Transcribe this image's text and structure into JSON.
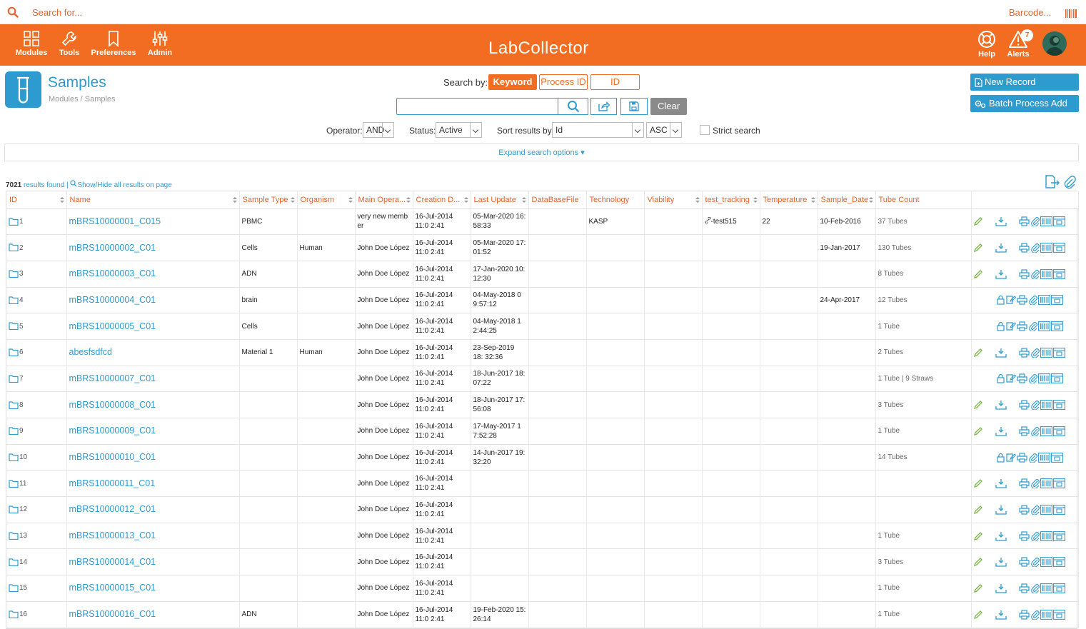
{
  "topbar": {
    "search_placeholder": "Search for...",
    "barcode_label": "Barcode..."
  },
  "nav": {
    "modules": "Modules",
    "tools": "Tools",
    "preferences": "Preferences",
    "admin": "Admin",
    "logo": "LabCollector",
    "help": "Help",
    "alerts": "Alerts",
    "alert_count": "7"
  },
  "page": {
    "title": "Samples",
    "breadcrumb": "Modules / Samples",
    "search_by_label": "Search by:",
    "search_by_options": [
      "Keyword",
      "Process ID",
      "ID"
    ],
    "clear_label": "Clear",
    "operator_label": "Operator:",
    "operator_value": "AND",
    "status_label": "Status:",
    "status_value": "Active",
    "sort_label": "Sort results by:",
    "sort_value": "Id",
    "sort_dir": "ASC",
    "strict_label": "Strict search",
    "new_record": "New Record",
    "batch_add": "Batch Process Add",
    "expand_label": "Expand search options ▾",
    "results_count": "7021",
    "results_label": " results found | ",
    "show_hide": "Show/Hide all results on page"
  },
  "table": {
    "headers": [
      "ID",
      "Name",
      "Sample Type",
      "Organism",
      "Main Opera...",
      "Creation D...",
      "Last Update",
      "DataBaseFile",
      "Technology",
      "Viability",
      "test_tracking",
      "Temperature",
      "Sample_Date",
      "Tube Count"
    ],
    "rows": [
      {
        "id": "1",
        "name": "mBRS10000001_C015",
        "type": "PBMC",
        "org": "",
        "op": "very new memb er",
        "created": "16-Jul-2014 11:0 2:41",
        "updated": "05-Mar-2020 16: 58:33",
        "db": "",
        "tech": "KASP",
        "via": "",
        "track": "-test515",
        "temp": "22",
        "sdate": "10-Feb-2016",
        "tubes": "37 Tubes",
        "locked": false
      },
      {
        "id": "2",
        "name": "mBRS10000002_C01",
        "type": "Cells",
        "org": "Human",
        "op": "John Doe López",
        "created": "16-Jul-2014 11:0 2:41",
        "updated": "05-Mar-2020 17: 01:52",
        "db": "",
        "tech": "",
        "via": "",
        "track": "",
        "temp": "",
        "sdate": "19-Jan-2017",
        "tubes": "130 Tubes",
        "locked": false
      },
      {
        "id": "3",
        "name": "mBRS10000003_C01",
        "type": "ADN",
        "org": "",
        "op": "John Doe López",
        "created": "16-Jul-2014 11:0 2:41",
        "updated": "17-Jan-2020 10: 12:30",
        "db": "",
        "tech": "",
        "via": "",
        "track": "",
        "temp": "",
        "sdate": "",
        "tubes": "8 Tubes",
        "locked": false
      },
      {
        "id": "4",
        "name": "mBRS10000004_C01",
        "type": "brain",
        "org": "",
        "op": "John Doe López",
        "created": "16-Jul-2014 11:0 2:41",
        "updated": "04-May-2018 0 9:57:12",
        "db": "",
        "tech": "",
        "via": "",
        "track": "",
        "temp": "",
        "sdate": "24-Apr-2017",
        "tubes": "12 Tubes",
        "locked": true
      },
      {
        "id": "5",
        "name": "mBRS10000005_C01",
        "type": "Cells",
        "org": "",
        "op": "John Doe López",
        "created": "16-Jul-2014 11:0 2:41",
        "updated": "04-May-2018 1 2:44:25",
        "db": "",
        "tech": "",
        "via": "",
        "track": "",
        "temp": "",
        "sdate": "",
        "tubes": "1 Tube",
        "locked": true
      },
      {
        "id": "6",
        "name": "abesfsdfcd",
        "type": "Material 1",
        "org": "Human",
        "op": "John Doe López",
        "created": "16-Jul-2014 11:0 2:41",
        "updated": "23-Sep-2019 18: 32:36",
        "db": "",
        "tech": "",
        "via": "",
        "track": "",
        "temp": "",
        "sdate": "",
        "tubes": "2 Tubes",
        "locked": false
      },
      {
        "id": "7",
        "name": "mBRS10000007_C01",
        "type": "",
        "org": "",
        "op": "John Doe López",
        "created": "16-Jul-2014 11:0 2:41",
        "updated": "18-Jun-2017 18: 07:22",
        "db": "",
        "tech": "",
        "via": "",
        "track": "",
        "temp": "",
        "sdate": "",
        "tubes": "1 Tube | 9 Straws",
        "locked": true
      },
      {
        "id": "8",
        "name": "mBRS10000008_C01",
        "type": "",
        "org": "",
        "op": "John Doe López",
        "created": "16-Jul-2014 11:0 2:41",
        "updated": "18-Jun-2017 17: 56:08",
        "db": "",
        "tech": "",
        "via": "",
        "track": "",
        "temp": "",
        "sdate": "",
        "tubes": "3 Tubes",
        "locked": false
      },
      {
        "id": "9",
        "name": "mBRS10000009_C01",
        "type": "",
        "org": "",
        "op": "John Doe López",
        "created": "16-Jul-2014 11:0 2:41",
        "updated": "17-May-2017 1 7:52:28",
        "db": "",
        "tech": "",
        "via": "",
        "track": "",
        "temp": "",
        "sdate": "",
        "tubes": "1 Tube",
        "locked": false
      },
      {
        "id": "10",
        "name": "mBRS10000010_C01",
        "type": "",
        "org": "",
        "op": "John Doe López",
        "created": "16-Jul-2014 11:0 2:41",
        "updated": "14-Jun-2017 19: 32:20",
        "db": "",
        "tech": "",
        "via": "",
        "track": "",
        "temp": "",
        "sdate": "",
        "tubes": "14 Tubes",
        "locked": true
      },
      {
        "id": "11",
        "name": "mBRS10000011_C01",
        "type": "",
        "org": "",
        "op": "John Doe López",
        "created": "16-Jul-2014 11:0 2:41",
        "updated": "",
        "db": "",
        "tech": "",
        "via": "",
        "track": "",
        "temp": "",
        "sdate": "",
        "tubes": "",
        "locked": false
      },
      {
        "id": "12",
        "name": "mBRS10000012_C01",
        "type": "",
        "org": "",
        "op": "John Doe López",
        "created": "16-Jul-2014 11:0 2:41",
        "updated": "",
        "db": "",
        "tech": "",
        "via": "",
        "track": "",
        "temp": "",
        "sdate": "",
        "tubes": "",
        "locked": false
      },
      {
        "id": "13",
        "name": "mBRS10000013_C01",
        "type": "",
        "org": "",
        "op": "John Doe López",
        "created": "16-Jul-2014 11:0 2:41",
        "updated": "",
        "db": "",
        "tech": "",
        "via": "",
        "track": "",
        "temp": "",
        "sdate": "",
        "tubes": "1 Tube",
        "locked": false
      },
      {
        "id": "14",
        "name": "mBRS10000014_C01",
        "type": "",
        "org": "",
        "op": "John Doe López",
        "created": "16-Jul-2014 11:0 2:41",
        "updated": "",
        "db": "",
        "tech": "",
        "via": "",
        "track": "",
        "temp": "",
        "sdate": "",
        "tubes": "3 Tubes",
        "locked": false
      },
      {
        "id": "15",
        "name": "mBRS10000015_C01",
        "type": "",
        "org": "",
        "op": "John Doe López",
        "created": "16-Jul-2014 11:0 2:41",
        "updated": "",
        "db": "",
        "tech": "",
        "via": "",
        "track": "",
        "temp": "",
        "sdate": "",
        "tubes": "1 Tube",
        "locked": false
      },
      {
        "id": "16",
        "name": "mBRS10000016_C01",
        "type": "ADN",
        "org": "",
        "op": "John Doe López",
        "created": "16-Jul-2014 11:0 2:41",
        "updated": "19-Feb-2020 15: 26:14",
        "db": "",
        "tech": "",
        "via": "",
        "track": "",
        "temp": "",
        "sdate": "",
        "tubes": "1 Tube",
        "locked": false
      }
    ]
  },
  "colors": {
    "accent": "#f26d21",
    "link": "#2e9bd0",
    "edit": "#7ab648"
  }
}
